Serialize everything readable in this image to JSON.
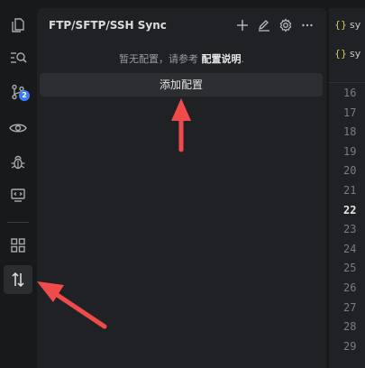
{
  "activity_bar": {
    "items": [
      {
        "icon": "files-icon"
      },
      {
        "icon": "search-icon"
      },
      {
        "icon": "source-control-icon",
        "badge": "2"
      },
      {
        "icon": "eye-icon"
      },
      {
        "icon": "debug-icon"
      },
      {
        "icon": "remote-explorer-icon"
      },
      {
        "icon": "extensions-icon"
      },
      {
        "icon": "sftp-sync-icon"
      }
    ]
  },
  "panel": {
    "title": "FTP/SFTP/SSH Sync",
    "actions": [
      "plus-icon",
      "edit-icon",
      "gear-icon",
      "more-icon"
    ],
    "hint_prefix": "暂无配置，请参考 ",
    "hint_link": "配置说明",
    "hint_suffix": ".",
    "add_button_label": "添加配置"
  },
  "editor": {
    "tabs": [
      {
        "icon_text": "{}",
        "label": "sy"
      },
      {
        "icon_text": "{}",
        "label": "sy"
      }
    ],
    "line_numbers": [
      "16",
      "17",
      "18",
      "19",
      "20",
      "21",
      "22",
      "23",
      "24",
      "25",
      "26",
      "27",
      "28",
      "29"
    ],
    "current_line": "22"
  },
  "annotation_color": "#f04b4b"
}
